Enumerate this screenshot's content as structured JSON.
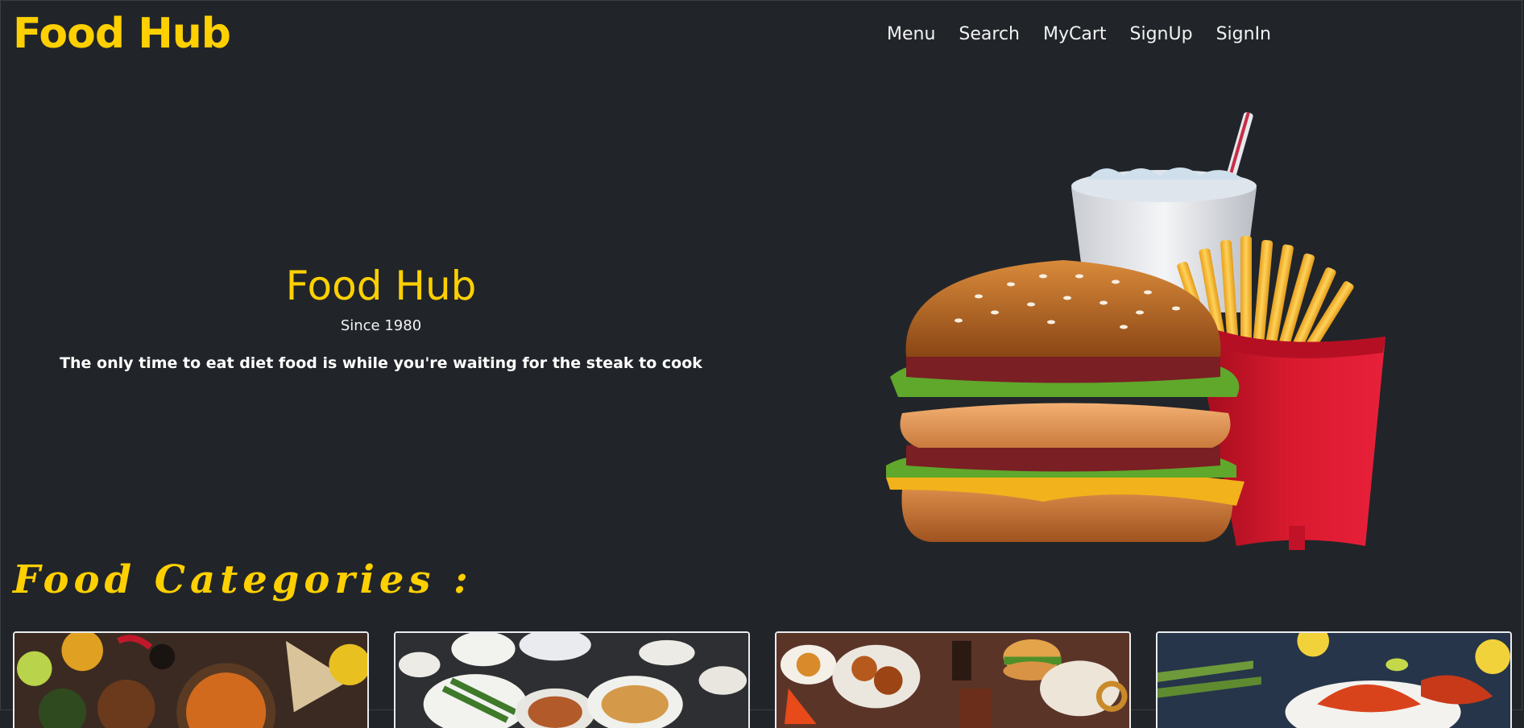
{
  "header": {
    "brand": "Food Hub",
    "nav": [
      "Menu",
      "Search",
      "MyCart",
      "SignUp",
      "SignIn"
    ]
  },
  "hero": {
    "title": "Food Hub",
    "since": "Since 1980",
    "quote": "The only time to eat diet food is while you're waiting for the steak to cook",
    "image_icon": "burger-fries-drink-illustration"
  },
  "categories": {
    "title": "Food Categories :",
    "cards": [
      {
        "icon": "indian-food-image"
      },
      {
        "icon": "chinese-food-image"
      },
      {
        "icon": "fast-food-image"
      },
      {
        "icon": "seafood-image"
      }
    ]
  },
  "colors": {
    "background": "#212529",
    "accent": "#ffd000",
    "text": "#f2f2f2"
  }
}
